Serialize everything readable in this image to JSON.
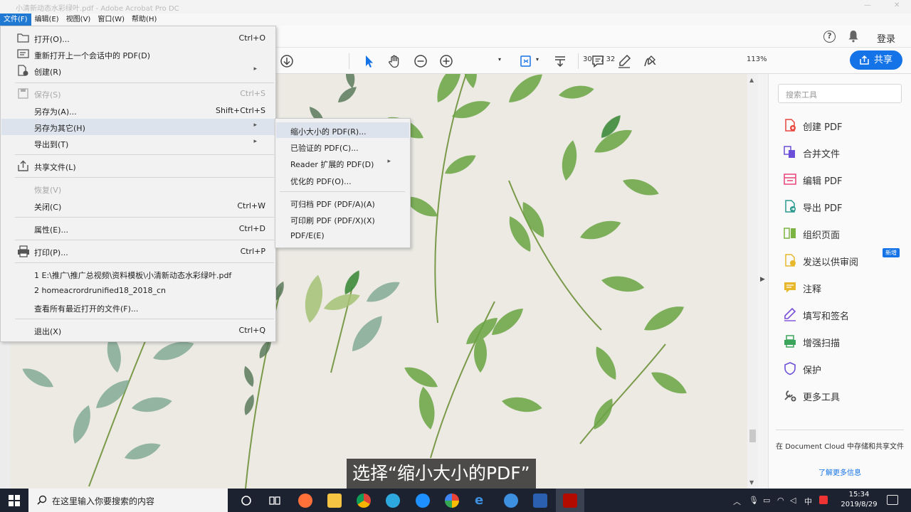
{
  "window": {
    "title": "小清新动态水彩绿叶.pdf - Adobe Acrobat Pro DC"
  },
  "menubar": [
    "文件(F)",
    "编辑(E)",
    "视图(V)",
    "窗口(W)",
    "帮助(H)"
  ],
  "topbar": {
    "help": "?",
    "login": "登录"
  },
  "toolbar": {
    "page_current": "30",
    "page_total": "/ 32",
    "zoom": "113%",
    "share_label": "共享"
  },
  "file_menu": {
    "items": [
      {
        "label": "打开(O)...",
        "shortcut": "Ctrl+O"
      },
      {
        "label": "重新打开上一个会话中的 PDF(D)",
        "shortcut": ""
      },
      {
        "label": "创建(R)",
        "shortcut": ""
      },
      {
        "label": "保存(S)",
        "shortcut": "Ctrl+S"
      },
      {
        "label": "另存为(A)...",
        "shortcut": "Shift+Ctrl+S"
      },
      {
        "label": "另存为其它(H)",
        "shortcut": ""
      },
      {
        "label": "导出到(T)",
        "shortcut": ""
      },
      {
        "label": "共享文件(L)",
        "shortcut": ""
      },
      {
        "label": "恢复(V)",
        "shortcut": ""
      },
      {
        "label": "关闭(C)",
        "shortcut": "Ctrl+W"
      },
      {
        "label": "属性(E)...",
        "shortcut": "Ctrl+D"
      },
      {
        "label": "打印(P)...",
        "shortcut": "Ctrl+P"
      },
      {
        "label": "1 E:\\推广\\推广总视频\\资料模板\\小清新动态水彩绿叶.pdf",
        "shortcut": ""
      },
      {
        "label": "2 homeacrordrunified18_2018_cn",
        "shortcut": ""
      },
      {
        "label": "查看所有最近打开的文件(F)...",
        "shortcut": ""
      },
      {
        "label": "退出(X)",
        "shortcut": "Ctrl+Q"
      }
    ]
  },
  "save_as_other_submenu": {
    "items": [
      "缩小大小的 PDF(R)...",
      "已验证的 PDF(C)...",
      "Reader 扩展的 PDF(D)",
      "优化的 PDF(O)...",
      "可归档 PDF (PDF/A)(A)",
      "可印刷 PDF (PDF/X)(X)",
      "PDF/E(E)"
    ]
  },
  "tools_pane": {
    "search_placeholder": "搜索工具",
    "tools": [
      {
        "label": "创建 PDF",
        "icon": "create-pdf-icon",
        "color": "#e8453c"
      },
      {
        "label": "合并文件",
        "icon": "combine-files-icon",
        "color": "#6b4fd8"
      },
      {
        "label": "编辑 PDF",
        "icon": "edit-pdf-icon",
        "color": "#e8457a"
      },
      {
        "label": "导出 PDF",
        "icon": "export-pdf-icon",
        "color": "#2b9a8f"
      },
      {
        "label": "组织页面",
        "icon": "organize-pages-icon",
        "color": "#7cb342"
      },
      {
        "label": "发送以供审阅",
        "icon": "send-review-icon",
        "color": "#e8b82c"
      },
      {
        "label": "注释",
        "icon": "comment-icon",
        "color": "#e8b82c"
      },
      {
        "label": "填写和签名",
        "icon": "fill-sign-icon",
        "color": "#7a4fd8"
      },
      {
        "label": "增强扫描",
        "icon": "enhance-scan-icon",
        "color": "#3aa55a"
      },
      {
        "label": "保护",
        "icon": "protect-icon",
        "color": "#6b4fd8"
      },
      {
        "label": "更多工具",
        "icon": "more-tools-icon",
        "color": "#555555"
      }
    ],
    "new_badge": "新增",
    "cloud_text": "在 Document Cloud 中存储和共享文件",
    "cloud_link": "了解更多信息"
  },
  "subtitle": "选择“缩小大小的PDF”",
  "taskbar": {
    "search_placeholder": "在这里输入你要搜索的内容",
    "time": "15:34",
    "date": "2019/8/29",
    "ime": "中"
  },
  "colors": {
    "accent": "#1473e6",
    "menu_active": "#1f78d1",
    "leaf_green": "#6aa544"
  }
}
